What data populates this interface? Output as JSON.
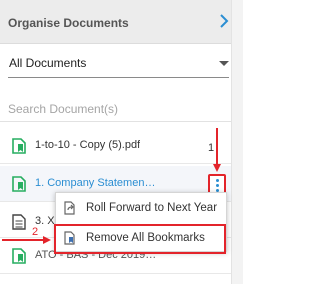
{
  "header": {
    "title": "Organise Documents"
  },
  "filter": {
    "selected": "All Documents"
  },
  "search": {
    "placeholder": "Search Document(s)"
  },
  "documents": [
    {
      "name": "1-to-10 - Copy (5).pdf",
      "icon": "bookmark-document-icon",
      "color": "#27ae60"
    },
    {
      "name": "1. Company Statemen…",
      "icon": "bookmark-document-icon",
      "color": "#27ae60",
      "selected": true
    },
    {
      "name": "3. X",
      "icon": "document-icon",
      "color": "#444444"
    },
    {
      "name": "ATO - BAS - Dec 2019…",
      "icon": "bookmark-document-icon",
      "color": "#27ae60"
    }
  ],
  "context_menu": {
    "items": [
      {
        "label": "Roll Forward to Next Year",
        "icon": "roll-forward-icon"
      },
      {
        "label": "Remove All Bookmarks",
        "icon": "remove-bookmark-icon"
      }
    ]
  },
  "annotations": {
    "step1": "1",
    "step2": "2"
  },
  "colors": {
    "accent": "#2b8ed2",
    "annotation": "#e3242b",
    "doc_green": "#27ae60"
  }
}
